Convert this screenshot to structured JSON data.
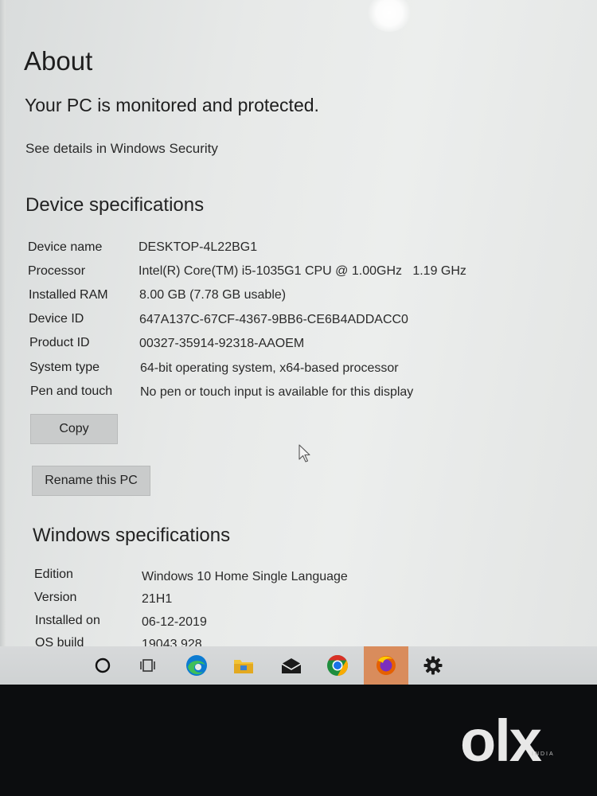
{
  "page": {
    "title": "About",
    "protection_status": "Your PC is monitored and protected.",
    "security_link": "See details in Windows Security"
  },
  "device_specs": {
    "heading": "Device specifications",
    "rows": [
      {
        "label": "Device name",
        "value": "DESKTOP-4L22BG1"
      },
      {
        "label": "Processor",
        "value": "Intel(R) Core(TM) i5-1035G1 CPU @ 1.00GHz   1.19 GHz"
      },
      {
        "label": "Installed RAM",
        "value": "8.00 GB (7.78 GB usable)"
      },
      {
        "label": "Device ID",
        "value": "647A137C-67CF-4367-9BB6-CE6B4ADDACC0"
      },
      {
        "label": "Product ID",
        "value": "00327-35914-92318-AAOEM"
      },
      {
        "label": "System type",
        "value": "64-bit operating system, x64-based processor"
      },
      {
        "label": "Pen and touch",
        "value": "No pen or touch input is available for this display"
      }
    ],
    "copy_label": "Copy",
    "rename_label": "Rename this PC"
  },
  "windows_specs": {
    "heading": "Windows specifications",
    "rows": [
      {
        "label": "Edition",
        "value": "Windows 10 Home Single Language"
      },
      {
        "label": "Version",
        "value": "21H1"
      },
      {
        "label": "Installed on",
        "value": "06-12-2019"
      },
      {
        "label": "OS build",
        "value": "19043.928"
      }
    ]
  },
  "taskbar": {
    "icons": [
      "search-circle-icon",
      "task-view-icon",
      "edge-icon",
      "file-explorer-icon",
      "mail-icon",
      "chrome-icon",
      "firefox-icon",
      "settings-gear-icon"
    ],
    "active_index": 6
  },
  "watermark": {
    "brand": "OLX",
    "logo_text": "olx",
    "sub_text": "INDIA"
  },
  "colors": {
    "screen_bg": "#e9ebea",
    "button_bg": "#c9cbcb",
    "taskbar_bg": "#d3d5d6",
    "active_taskbar": "#d98c5c",
    "chrome_red": "#d93025",
    "chrome_green": "#1e8e3e",
    "chrome_yellow": "#f9ab00",
    "edge_blue": "#0c7bd1",
    "folder_yellow": "#f2c335"
  }
}
